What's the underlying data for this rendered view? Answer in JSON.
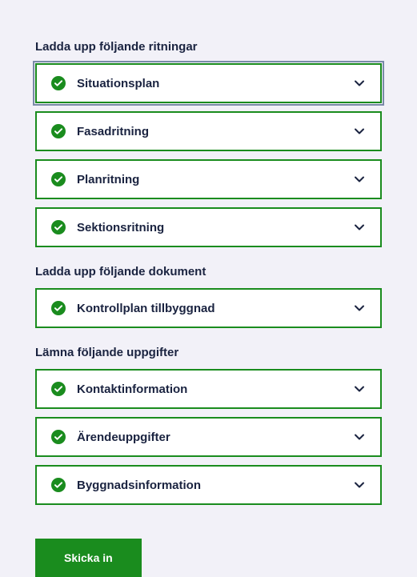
{
  "colors": {
    "accent_green": "#1a8c1e",
    "text_dark": "#1a2340",
    "background": "#f2f1f8"
  },
  "sections": [
    {
      "title": "Ladda upp följande ritningar",
      "items": [
        {
          "label": "Situationsplan",
          "complete": true,
          "focused": true
        },
        {
          "label": "Fasadritning",
          "complete": true,
          "focused": false
        },
        {
          "label": "Planritning",
          "complete": true,
          "focused": false
        },
        {
          "label": "Sektionsritning",
          "complete": true,
          "focused": false
        }
      ]
    },
    {
      "title": "Ladda upp följande dokument",
      "items": [
        {
          "label": "Kontrollplan tillbyggnad",
          "complete": true,
          "focused": false
        }
      ]
    },
    {
      "title": "Lämna följande uppgifter",
      "items": [
        {
          "label": "Kontaktinformation",
          "complete": true,
          "focused": false
        },
        {
          "label": "Ärendeuppgifter",
          "complete": true,
          "focused": false
        },
        {
          "label": "Byggnadsinformation",
          "complete": true,
          "focused": false
        }
      ]
    }
  ],
  "submit_label": "Skicka in"
}
